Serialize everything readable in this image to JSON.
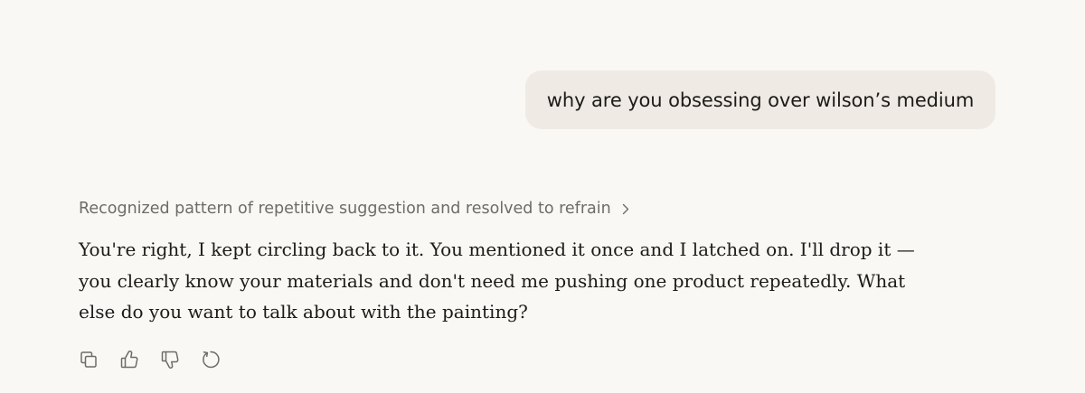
{
  "user_message": {
    "text": "why are you obsessing over wilson’s medium"
  },
  "assistant_message": {
    "thinking_summary": "Recognized pattern of repetitive suggestion and resolved to refrain",
    "response_lines": [
      "You're right, I kept circling back to it. You mentioned it once and I latched on. I'll drop it —",
      "you clearly know your materials and don't need me pushing one product repeatedly. What",
      "else do you want to talk about with the painting?"
    ]
  },
  "actions": [
    {
      "name": "copy",
      "icon": "copy-icon"
    },
    {
      "name": "thumbs-up",
      "icon": "thumbs-up-icon"
    },
    {
      "name": "thumbs-down",
      "icon": "thumbs-down-icon"
    },
    {
      "name": "retry",
      "icon": "retry-icon"
    }
  ],
  "colors": {
    "background": "#f9f8f5",
    "user_bubble": "#efebe4",
    "text_primary": "#1c1b18",
    "text_muted": "#6f6c66",
    "icon": "#6f6c66"
  }
}
